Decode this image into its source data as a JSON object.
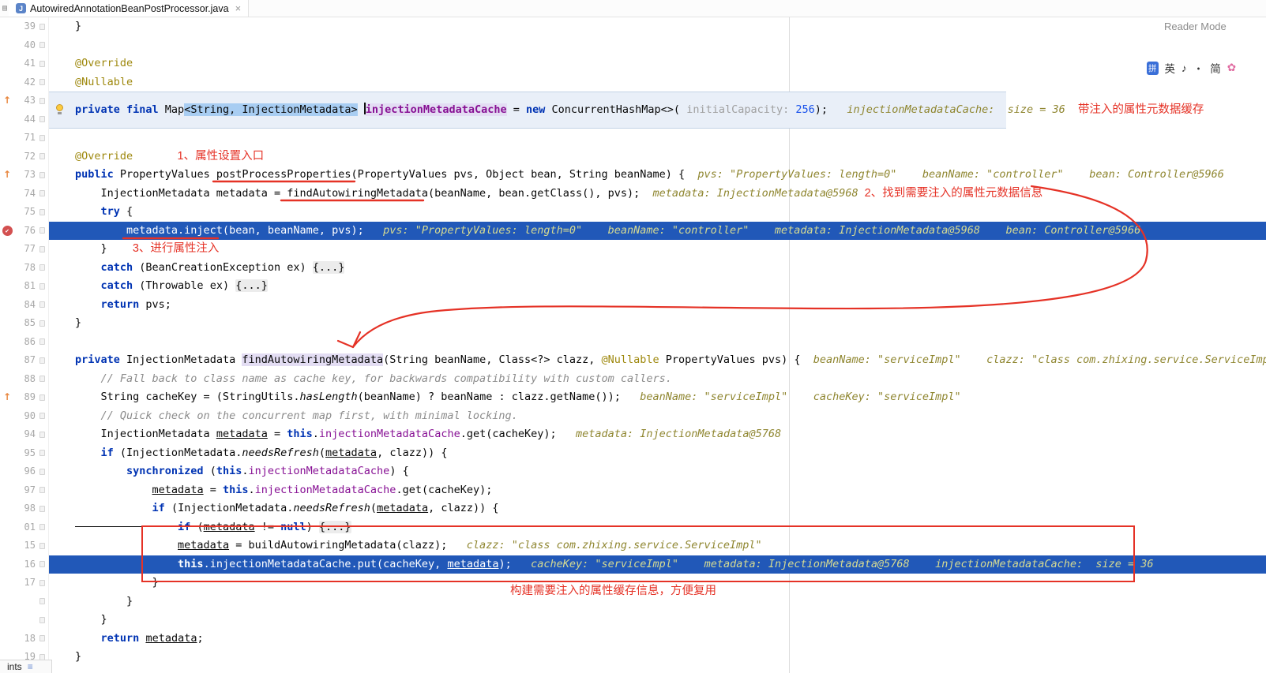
{
  "tab_bar": {
    "tab_title": "AutowiredAnnotationBeanPostProcessor.java",
    "close": "×"
  },
  "top_right": {
    "reader_mode": "Reader Mode",
    "ime_items": [
      "拼",
      "英",
      "♪",
      "・",
      "简",
      "✿"
    ]
  },
  "bottom_left": {
    "label": "ints",
    "icon": "≡"
  },
  "icons": {
    "breakpoint_check": "✔",
    "override_arrow": "↑",
    "window_icon": "▤",
    "java_class_letter": "J"
  },
  "annotations": {
    "note_cache": "带注入的属性元数据缓存",
    "note_entry": "1、属性设置入口",
    "note_find": "2、找到需要注入的属性元数据信息",
    "note_inject": "3、进行属性注入",
    "note_build": "构建需要注入的属性缓存信息，方便复用"
  },
  "editor": {
    "rows": [
      {
        "num": "39",
        "tokens": [
          [
            "p",
            "}"
          ]
        ]
      },
      {
        "num": "40",
        "tokens": []
      },
      {
        "num": "41",
        "tokens": [
          [
            "a",
            "@Override"
          ]
        ]
      },
      {
        "num": "42",
        "tokens": [
          [
            "a",
            "@Nullable"
          ]
        ]
      },
      {
        "type": "band",
        "nums": [
          "43",
          "44"
        ],
        "icon": "arrow",
        "tokens": [
          [
            "k",
            "private final "
          ],
          [
            "p",
            "Map"
          ],
          [
            "sel",
            "<String, InjectionMetadata>"
          ],
          [
            "p",
            " "
          ],
          [
            "caret",
            ""
          ],
          [
            "occf",
            "injectionMetadataCache"
          ],
          [
            "p",
            " = "
          ],
          [
            "k",
            "new"
          ],
          [
            "p",
            " ConcurrentHashMap<>( "
          ],
          [
            "ph",
            "initialCapacity: "
          ],
          [
            "n",
            "256"
          ],
          [
            "p",
            ");"
          ],
          [
            "h",
            "   injectionMetadataCache:  size = 36"
          ],
          [
            "r",
            "    带注入的属性元数据缓存"
          ]
        ]
      },
      {
        "num": "71",
        "tokens": []
      },
      {
        "num": "72",
        "tokens": [
          [
            "a",
            "@Override"
          ],
          [
            "r",
            "              1、属性设置入口"
          ]
        ]
      },
      {
        "num": "73",
        "icon": "arrow",
        "tokens": [
          [
            "k",
            "public "
          ],
          [
            "p",
            "PropertyValues postProcessProperties(PropertyValues pvs, Object bean, String beanName) {"
          ],
          [
            "h",
            "  pvs: \"PropertyValues: length=0\"    beanName: \"controller\"    bean: Controller@5966"
          ]
        ]
      },
      {
        "num": "74",
        "tokens": [
          [
            "p",
            "    InjectionMetadata metadata = findAutowiringMetadata(beanName, bean.getClass(), pvs);"
          ],
          [
            "h",
            "  metadata: InjectionMetadata@5968"
          ],
          [
            "r",
            "  2、找到需要注入的属性元数据信息"
          ]
        ]
      },
      {
        "num": "75",
        "tokens": [
          [
            "p",
            "    "
          ],
          [
            "k",
            "try"
          ],
          [
            "p",
            " {"
          ]
        ]
      },
      {
        "type": "exec",
        "num": "76",
        "icon": "bp",
        "tokens": [
          [
            "p",
            "        metadata.inject(bean, beanName, pvs);"
          ],
          [
            "h",
            "   pvs: \"PropertyValues: length=0\"    beanName: \"controller\"    metadata: InjectionMetadata@5968    bean: Controller@5966"
          ]
        ]
      },
      {
        "num": "77",
        "tokens": [
          [
            "p",
            "    }"
          ],
          [
            "r",
            "        3、进行属性注入"
          ]
        ]
      },
      {
        "num": "78",
        "tokens": [
          [
            "p",
            "    "
          ],
          [
            "k",
            "catch"
          ],
          [
            "p",
            " (BeanCreationException ex) "
          ],
          [
            "fold",
            "{...}"
          ]
        ]
      },
      {
        "num": "81",
        "tokens": [
          [
            "p",
            "    "
          ],
          [
            "k",
            "catch"
          ],
          [
            "p",
            " (Throwable ex) "
          ],
          [
            "fold",
            "{...}"
          ]
        ]
      },
      {
        "num": "84",
        "tokens": [
          [
            "p",
            "    "
          ],
          [
            "k",
            "return"
          ],
          [
            "p",
            " pvs;"
          ]
        ]
      },
      {
        "num": "85",
        "tokens": [
          [
            "p",
            "}"
          ]
        ]
      },
      {
        "num": "86",
        "tokens": []
      },
      {
        "num": "87",
        "tokens": [
          [
            "k",
            "private "
          ],
          [
            "p",
            "InjectionMetadata "
          ],
          [
            "occ",
            "findAutowiringMetadata"
          ],
          [
            "p",
            "(String beanName, Class<?> clazz, "
          ],
          [
            "a",
            "@Nullable"
          ],
          [
            "p",
            " PropertyValues pvs) {"
          ],
          [
            "h",
            "  beanName: \"serviceImpl\"    clazz: \"class com.zhixing.service.ServiceImpl\""
          ]
        ]
      },
      {
        "num": "88",
        "tokens": [
          [
            "c",
            "    // Fall back to class name as cache key, for backwards compatibility with custom callers."
          ]
        ]
      },
      {
        "num": "89",
        "icon": "arrow",
        "tokens": [
          [
            "p",
            "    String cacheKey = (StringUtils."
          ],
          [
            "m",
            "hasLength"
          ],
          [
            "p",
            "(beanName) ? beanName : clazz.getName());"
          ],
          [
            "h",
            "   beanName: \"serviceImpl\"    cacheKey: \"serviceImpl\""
          ]
        ]
      },
      {
        "num": "90",
        "tokens": [
          [
            "c",
            "    // Quick check on the concurrent map first, with minimal locking."
          ]
        ]
      },
      {
        "num": "94",
        "tokens": [
          [
            "p",
            "    InjectionMetadata "
          ],
          [
            "u",
            "metadata"
          ],
          [
            "p",
            " = "
          ],
          [
            "k",
            "this"
          ],
          [
            "p",
            "."
          ],
          [
            "f",
            "injectionMetadataCache"
          ],
          [
            "p",
            ".get(cacheKey);"
          ],
          [
            "h",
            "   metadata: InjectionMetadata@5768"
          ]
        ]
      },
      {
        "num": "95",
        "tokens": [
          [
            "p",
            "    "
          ],
          [
            "k",
            "if"
          ],
          [
            "p",
            " (InjectionMetadata."
          ],
          [
            "m",
            "needsRefresh"
          ],
          [
            "p",
            "("
          ],
          [
            "u",
            "metadata"
          ],
          [
            "p",
            ", clazz)) {"
          ]
        ]
      },
      {
        "num": "96",
        "tokens": [
          [
            "p",
            "        "
          ],
          [
            "k",
            "synchronized"
          ],
          [
            "p",
            " ("
          ],
          [
            "k",
            "this"
          ],
          [
            "p",
            "."
          ],
          [
            "f",
            "injectionMetadataCache"
          ],
          [
            "p",
            ") {"
          ]
        ]
      },
      {
        "num": "97",
        "tokens": [
          [
            "p",
            "            "
          ],
          [
            "u",
            "metadata"
          ],
          [
            "p",
            " = "
          ],
          [
            "k",
            "this"
          ],
          [
            "p",
            "."
          ],
          [
            "f",
            "injectionMetadataCache"
          ],
          [
            "p",
            ".get(cacheKey);"
          ]
        ]
      },
      {
        "num": "98",
        "tokens": [
          [
            "p",
            "            "
          ],
          [
            "k",
            "if"
          ],
          [
            "p",
            " (InjectionMetadata."
          ],
          [
            "m",
            "needsRefresh"
          ],
          [
            "p",
            "("
          ],
          [
            "u",
            "metadata"
          ],
          [
            "p",
            ", clazz)) {"
          ]
        ]
      },
      {
        "type": "strike",
        "num": "01",
        "tokens": [
          [
            "p",
            "                "
          ],
          [
            "k",
            "if"
          ],
          [
            "p",
            " ("
          ],
          [
            "u",
            "metadata"
          ],
          [
            "p",
            " != "
          ],
          [
            "k",
            "null"
          ],
          [
            "p",
            ") "
          ],
          [
            "fold",
            "{...}"
          ]
        ]
      },
      {
        "num": "15",
        "tokens": [
          [
            "p",
            "                "
          ],
          [
            "u",
            "metadata"
          ],
          [
            "p",
            " = buildAutowiringMetadata(clazz);"
          ],
          [
            "h",
            "   clazz: \"class com.zhixing.service.ServiceImpl\""
          ]
        ]
      },
      {
        "type": "exec",
        "num": "16",
        "tokens": [
          [
            "p",
            "                "
          ],
          [
            "k",
            "this"
          ],
          [
            "p",
            "."
          ],
          [
            "f",
            "injectionMetadataCache"
          ],
          [
            "p",
            ".put(cacheKey, "
          ],
          [
            "u",
            "metadata"
          ],
          [
            "p",
            ");"
          ],
          [
            "h",
            "   cacheKey: \"serviceImpl\"    metadata: InjectionMetadata@5768    injectionMetadataCache:  size = 36"
          ]
        ]
      },
      {
        "num": "17",
        "tokens": [
          [
            "p",
            "            }"
          ]
        ]
      },
      {
        "num": "",
        "tokens": [
          [
            "p",
            "        }"
          ]
        ]
      },
      {
        "num": "",
        "tokens": [
          [
            "p",
            "    }"
          ]
        ]
      },
      {
        "num": "18",
        "tokens": [
          [
            "p",
            "    "
          ],
          [
            "k",
            "return"
          ],
          [
            "p",
            " "
          ],
          [
            "u",
            "metadata"
          ],
          [
            "p",
            ";"
          ]
        ]
      },
      {
        "num": "19",
        "tokens": [
          [
            "p",
            "}"
          ]
        ]
      }
    ]
  }
}
